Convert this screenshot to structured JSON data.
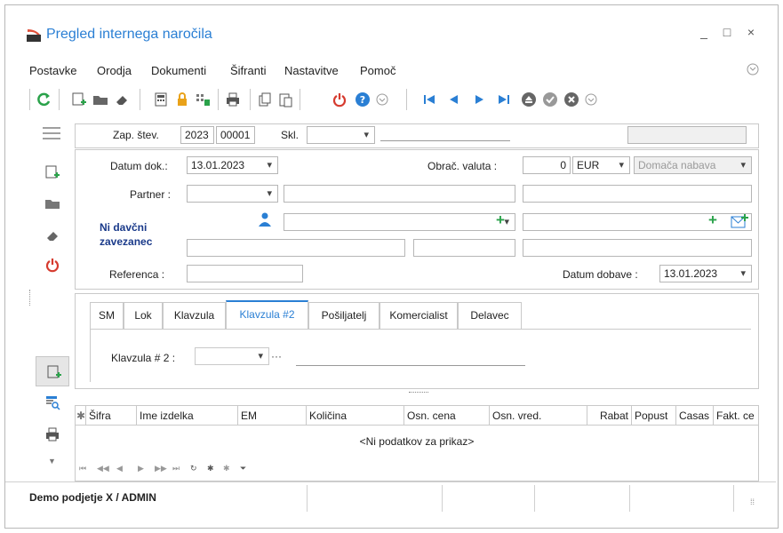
{
  "window": {
    "title": "Pregled internega naročila",
    "minimize": "_",
    "maximize": "□",
    "close": "×"
  },
  "menu": [
    "Postavke",
    "Orodja",
    "Dokumenti",
    "Šifranti",
    "Nastavitve",
    "Pomoč"
  ],
  "header": {
    "zap_label": "Zap. štev.",
    "zap_year": "2023",
    "zap_no": "00001",
    "skl_label": "Skl."
  },
  "form": {
    "datum_label": "Datum dok.:",
    "datum_value": "13.01.2023",
    "valuta_label": "Obrač. valuta :",
    "valuta_amount": "0",
    "valuta_code": "EUR",
    "nabava": "Domača nabava",
    "partner_label": "Partner :",
    "davcni": "Ni davčni zavezanec",
    "referenca_label": "Referenca :",
    "dobava_label": "Datum dobave :",
    "dobava_value": "13.01.2023"
  },
  "tabs": [
    "SM",
    "Lok",
    "Klavzula",
    "Klavzula #2",
    "Pošiljatelj",
    "Komercialist",
    "Delavec"
  ],
  "active_tab": "Klavzula #2",
  "tab_panel": {
    "label": "Klavzula # 2 :",
    "dots": "···"
  },
  "grid": {
    "columns": [
      "Šifra",
      "Ime izdelka",
      "EM",
      "Količina",
      "Osn. cena",
      "Osn. vred.",
      "Rabat",
      "Popust",
      "Casas",
      "Fakt. ce"
    ],
    "empty": "<Ni podatkov za prikaz>"
  },
  "status": {
    "company": "Demo podjetje X / ADMIN"
  },
  "colors": {
    "accent": "#2a7fd4",
    "green": "#2aa24a",
    "red": "#d63b2f"
  }
}
